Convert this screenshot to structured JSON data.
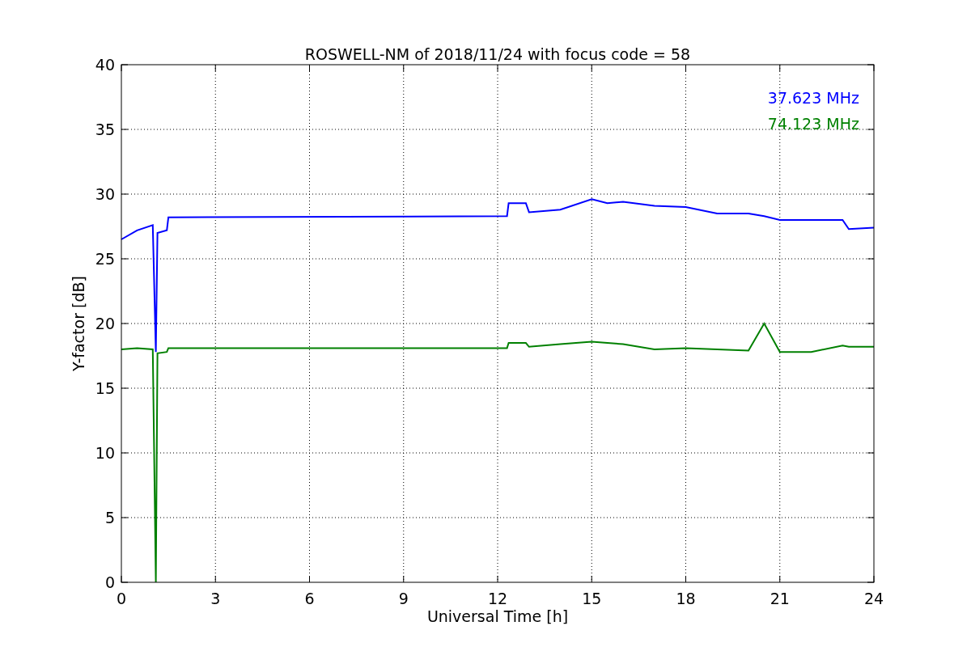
{
  "chart_data": {
    "type": "line",
    "title": "ROSWELL-NM of 2018/11/24 with focus code = 58",
    "xlabel": "Universal Time [h]",
    "ylabel": "Y-factor [dB]",
    "x": [
      0,
      0.5,
      1.0,
      1.1,
      1.15,
      1.45,
      1.5,
      12.3,
      12.35,
      12.9,
      13.0,
      14,
      15,
      15.5,
      16,
      17,
      18,
      19,
      20,
      20.5,
      21,
      22,
      23,
      23.2,
      24
    ],
    "series": [
      {
        "name": "37.623 MHz",
        "color": "#0000ff",
        "values": [
          26.5,
          27.2,
          27.6,
          17.8,
          27,
          27.2,
          28.2,
          28.3,
          29.3,
          29.3,
          28.6,
          28.8,
          29.6,
          29.3,
          29.4,
          29.1,
          29,
          28.5,
          28.5,
          28.3,
          28,
          28,
          28,
          27.3,
          27.4
        ]
      },
      {
        "name": "74.123 MHz",
        "color": "#008000",
        "values": [
          18,
          18.1,
          18,
          0,
          17.7,
          17.8,
          18.1,
          18.1,
          18.5,
          18.5,
          18.2,
          18.4,
          18.6,
          18.5,
          18.4,
          18,
          18.1,
          18,
          17.9,
          20,
          17.8,
          17.8,
          18.3,
          18.2,
          18.2
        ]
      }
    ],
    "xlim": [
      0,
      24
    ],
    "ylim": [
      0,
      40
    ],
    "grid": true,
    "xticks": [
      0,
      3,
      6,
      9,
      12,
      15,
      18,
      21,
      24
    ],
    "yticks": [
      0,
      5,
      10,
      15,
      20,
      25,
      30,
      35,
      40
    ]
  }
}
